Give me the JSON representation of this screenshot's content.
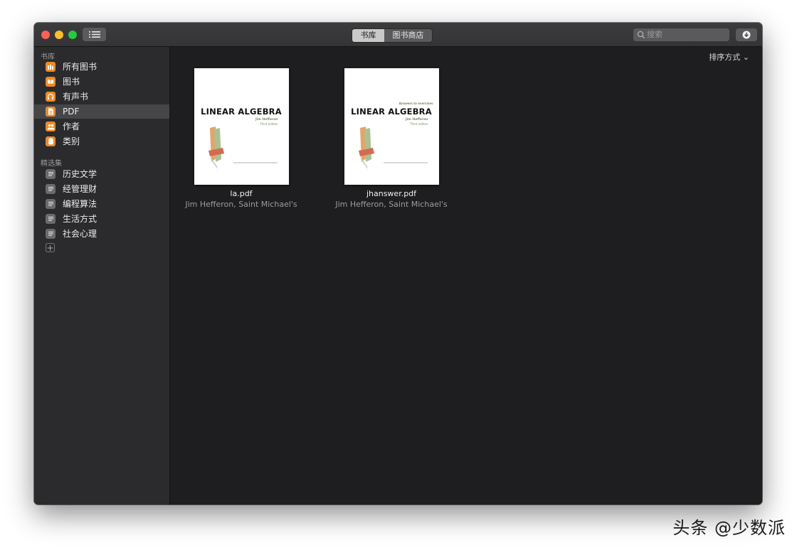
{
  "toolbar": {
    "segments": [
      {
        "label": "书库",
        "selected": true
      },
      {
        "label": "图书商店",
        "selected": false
      }
    ],
    "search_placeholder": "搜索"
  },
  "sidebar": {
    "library_header": "书库",
    "library_items": [
      {
        "label": "所有图书",
        "icon": "library-icon",
        "selected": false
      },
      {
        "label": "图书",
        "icon": "book-icon",
        "selected": false
      },
      {
        "label": "有声书",
        "icon": "headphones-icon",
        "selected": false
      },
      {
        "label": "PDF",
        "icon": "pdf-icon",
        "selected": true
      },
      {
        "label": "作者",
        "icon": "people-icon",
        "selected": false
      },
      {
        "label": "类别",
        "icon": "category-icon",
        "selected": false
      }
    ],
    "collections_header": "精选集",
    "collections": [
      {
        "label": "历史文学",
        "icon": "list-icon"
      },
      {
        "label": "经管理财",
        "icon": "list-icon"
      },
      {
        "label": "编程算法",
        "icon": "list-icon"
      },
      {
        "label": "生活方式",
        "icon": "list-icon"
      },
      {
        "label": "社会心理",
        "icon": "list-icon"
      }
    ],
    "add_label": "+"
  },
  "main": {
    "sort_label": "排序方式 ⌄",
    "books": [
      {
        "filename": "la.pdf",
        "author": "Jim Hefferon, Saint Michael's",
        "cover": {
          "subtitle": "",
          "title": "LINEAR ALGEBRA",
          "author": "Jim Hefferon",
          "edition": "Third edition"
        }
      },
      {
        "filename": "jhanswer.pdf",
        "author": "Jim Hefferon, Saint Michael's",
        "cover": {
          "subtitle": "Answers to exercises",
          "title": "LINEAR ALGEBRA",
          "author": "Jim Hefferon",
          "edition": "Third edition"
        }
      }
    ]
  },
  "watermark": "头条 @少数派",
  "colors": {
    "accent_orange": "#f08a24",
    "window_bg": "#1e1e20",
    "sidebar_bg": "#2b2b2d",
    "selected_row": "#464648"
  }
}
